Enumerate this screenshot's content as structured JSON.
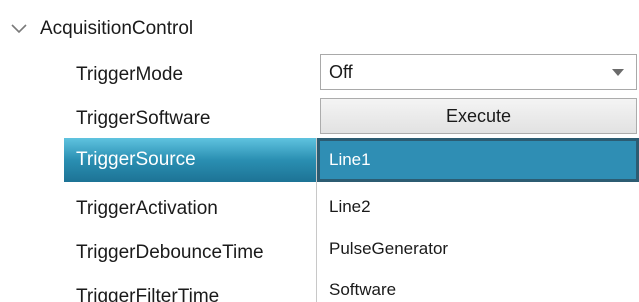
{
  "category": {
    "label": "AcquisitionControl",
    "icon": "chevron-down-icon"
  },
  "properties": [
    {
      "label": "TriggerMode"
    },
    {
      "label": "TriggerSoftware"
    },
    {
      "label": "TriggerSource"
    },
    {
      "label": "TriggerActivation"
    },
    {
      "label": "TriggerDebounceTime"
    },
    {
      "label": "TriggerFilterTime"
    }
  ],
  "editors": {
    "trigger_mode_value": "Off",
    "trigger_software_button": "Execute"
  },
  "dropdown": {
    "options": [
      "Line1",
      "Line2",
      "PulseGenerator",
      "Software"
    ],
    "selected": "Line1"
  },
  "colors": {
    "selection_accent": "#2f8eb4",
    "row_selected_gradient_top": "#5fc3df",
    "row_selected_gradient_bottom": "#1d7395"
  }
}
